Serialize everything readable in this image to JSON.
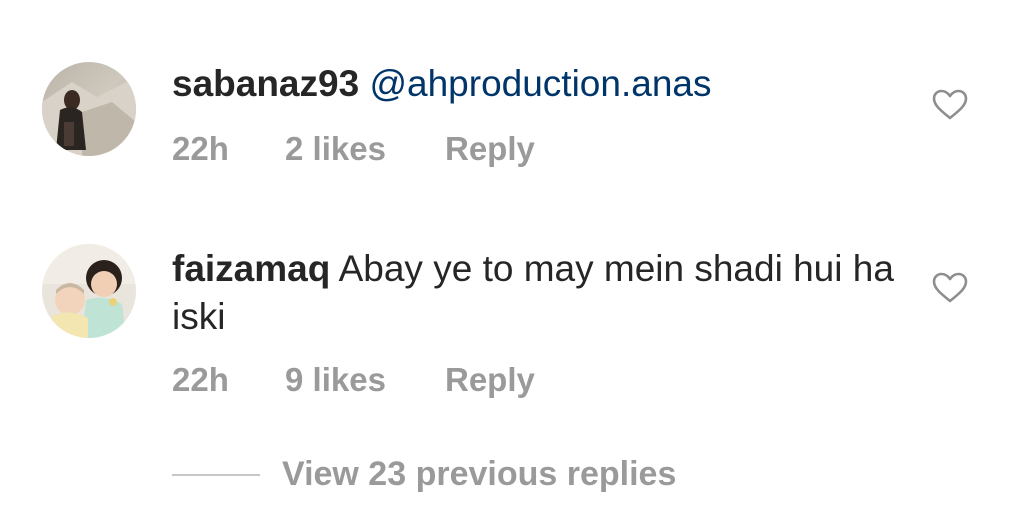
{
  "comments": [
    {
      "username": "sabanaz93",
      "mention": "@ahproduction.anas",
      "text": "",
      "time": "22h",
      "likes": "2 likes",
      "reply": "Reply",
      "avatar_icon": "user-avatar"
    },
    {
      "username": "faizamaq",
      "mention": "",
      "text": "Abay ye to may mein shadi hui ha iski",
      "time": "22h",
      "likes": "9 likes",
      "reply": "Reply",
      "avatar_icon": "user-avatar"
    }
  ],
  "view_replies": "View 23 previous replies",
  "icons": {
    "like": "heart-outline-icon"
  },
  "colors": {
    "text": "#262626",
    "mention": "#003569",
    "secondary": "#9a9a9a",
    "divider": "#c7c7c7"
  }
}
